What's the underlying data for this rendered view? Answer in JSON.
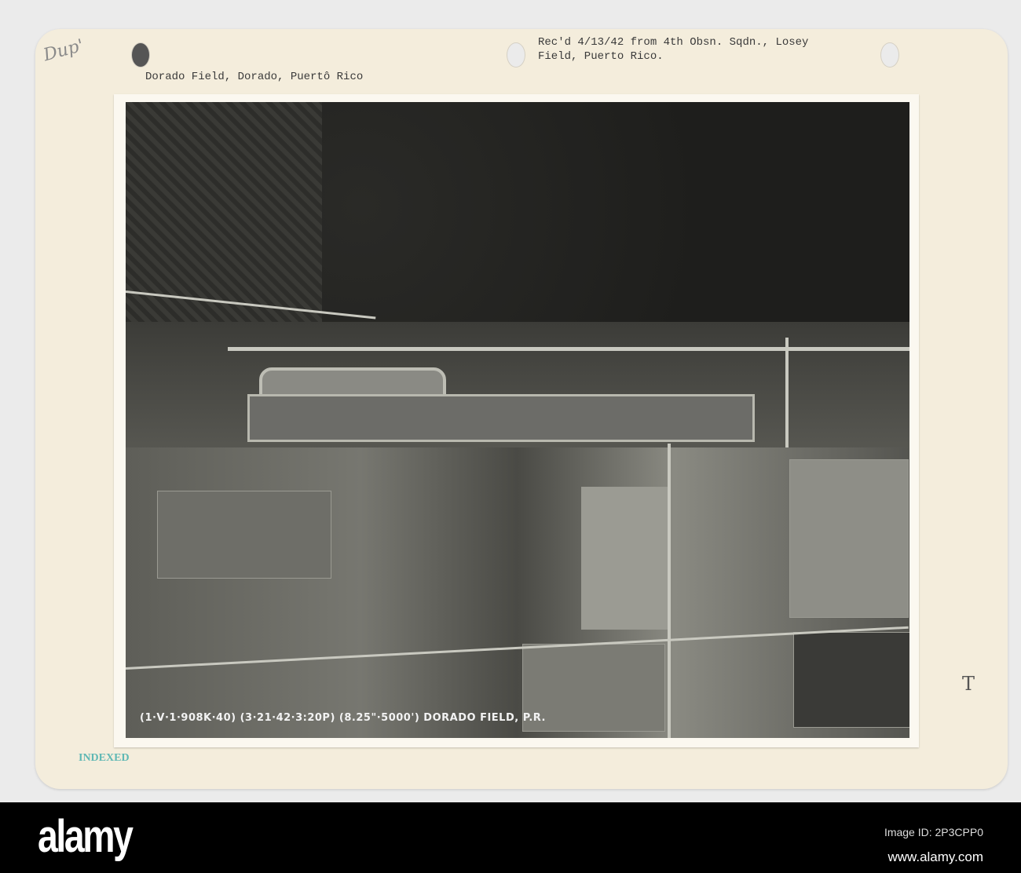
{
  "card": {
    "handwritten_note": "Dup'",
    "location_label": "Dorado Field, Dorado, Puertô Rico",
    "received_note_line1": "Rec'd 4/13/42 from 4th Obsn. Sqdn., Losey",
    "received_note_line2": "Field, Puerto Rico.",
    "photo_caption": "(1·V·1·908K·40) (3·21·42·3:20P) (8.25\"·5000') DORADO FIELD, P.R.",
    "margin_mark": "T",
    "stamp": "INDEXED"
  },
  "banner": {
    "logo": "alamy",
    "image_id": "Image ID: 2P3CPP0",
    "url": "www.alamy.com"
  }
}
